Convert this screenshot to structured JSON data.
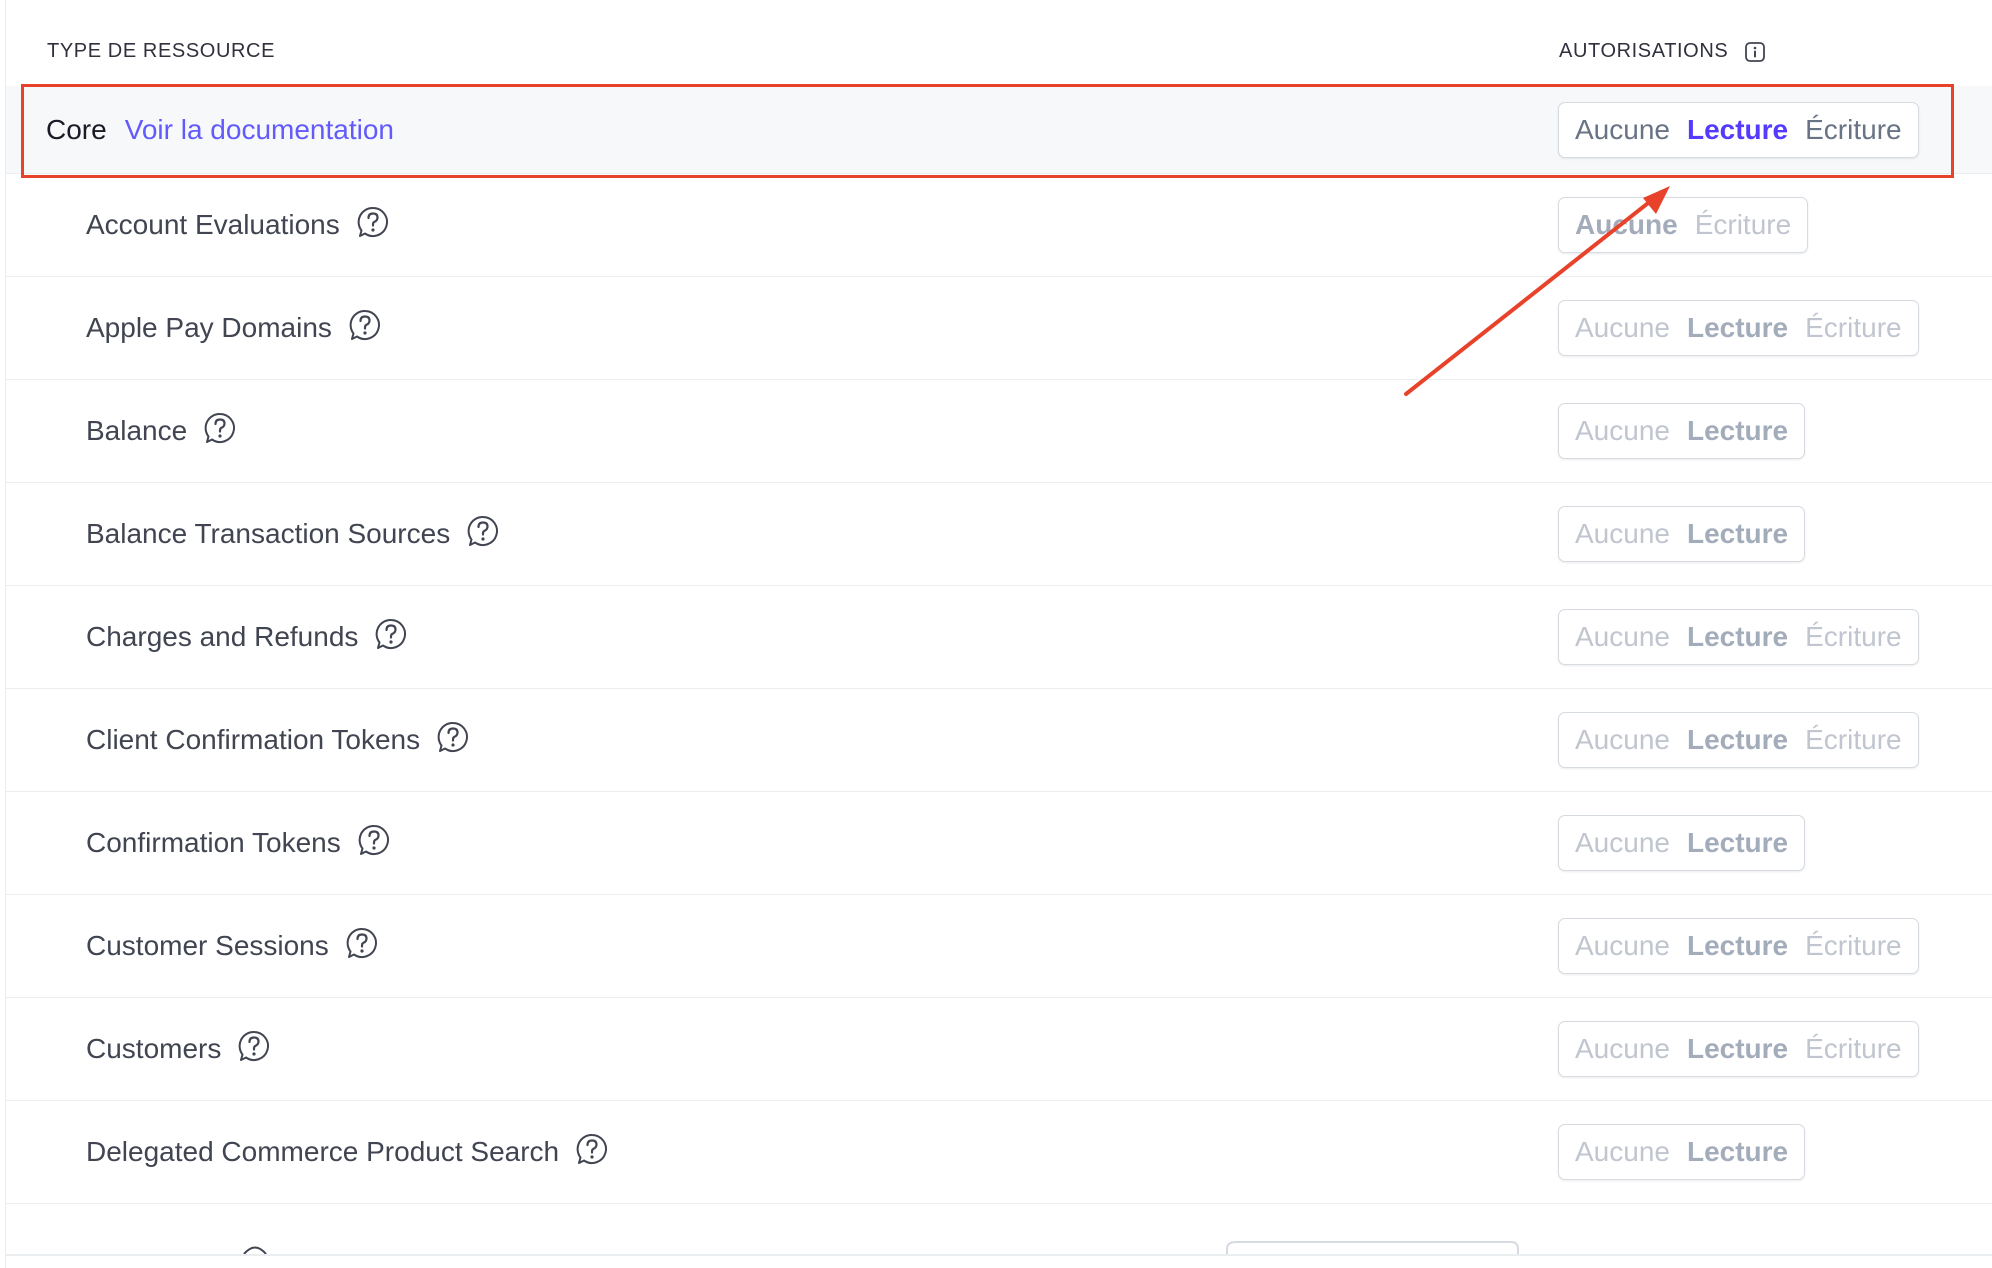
{
  "header": {
    "resource_type_label": "TYPE DE RESSOURCE",
    "permissions_label": "AUTORISATIONS",
    "info_icon": "info-icon"
  },
  "core": {
    "name": "Core",
    "doc_link": "Voir la documentation",
    "options": [
      "Aucune",
      "Lecture",
      "Écriture"
    ],
    "selected": "Lecture"
  },
  "resources": [
    {
      "name": "Account Evaluations",
      "options": [
        "Aucune",
        "Écriture"
      ]
    },
    {
      "name": "Apple Pay Domains",
      "options": [
        "Aucune",
        "Lecture",
        "Écriture"
      ]
    },
    {
      "name": "Balance",
      "options": [
        "Aucune",
        "Lecture"
      ]
    },
    {
      "name": "Balance Transaction Sources",
      "options": [
        "Aucune",
        "Lecture"
      ]
    },
    {
      "name": "Charges and Refunds",
      "options": [
        "Aucune",
        "Lecture",
        "Écriture"
      ]
    },
    {
      "name": "Client Confirmation Tokens",
      "options": [
        "Aucune",
        "Lecture",
        "Écriture"
      ]
    },
    {
      "name": "Confirmation Tokens",
      "options": [
        "Aucune",
        "Lecture"
      ]
    },
    {
      "name": "Customer Sessions",
      "options": [
        "Aucune",
        "Lecture",
        "Écriture"
      ]
    },
    {
      "name": "Customers",
      "options": [
        "Aucune",
        "Lecture",
        "Écriture"
      ]
    },
    {
      "name": "Delegated Commerce Product Search",
      "options": [
        "Aucune",
        "Lecture"
      ]
    }
  ],
  "annotation": {
    "color": "#e8432a"
  },
  "colors": {
    "accent": "#533afd",
    "link": "#625afa",
    "muted": "#c0c5cf"
  }
}
